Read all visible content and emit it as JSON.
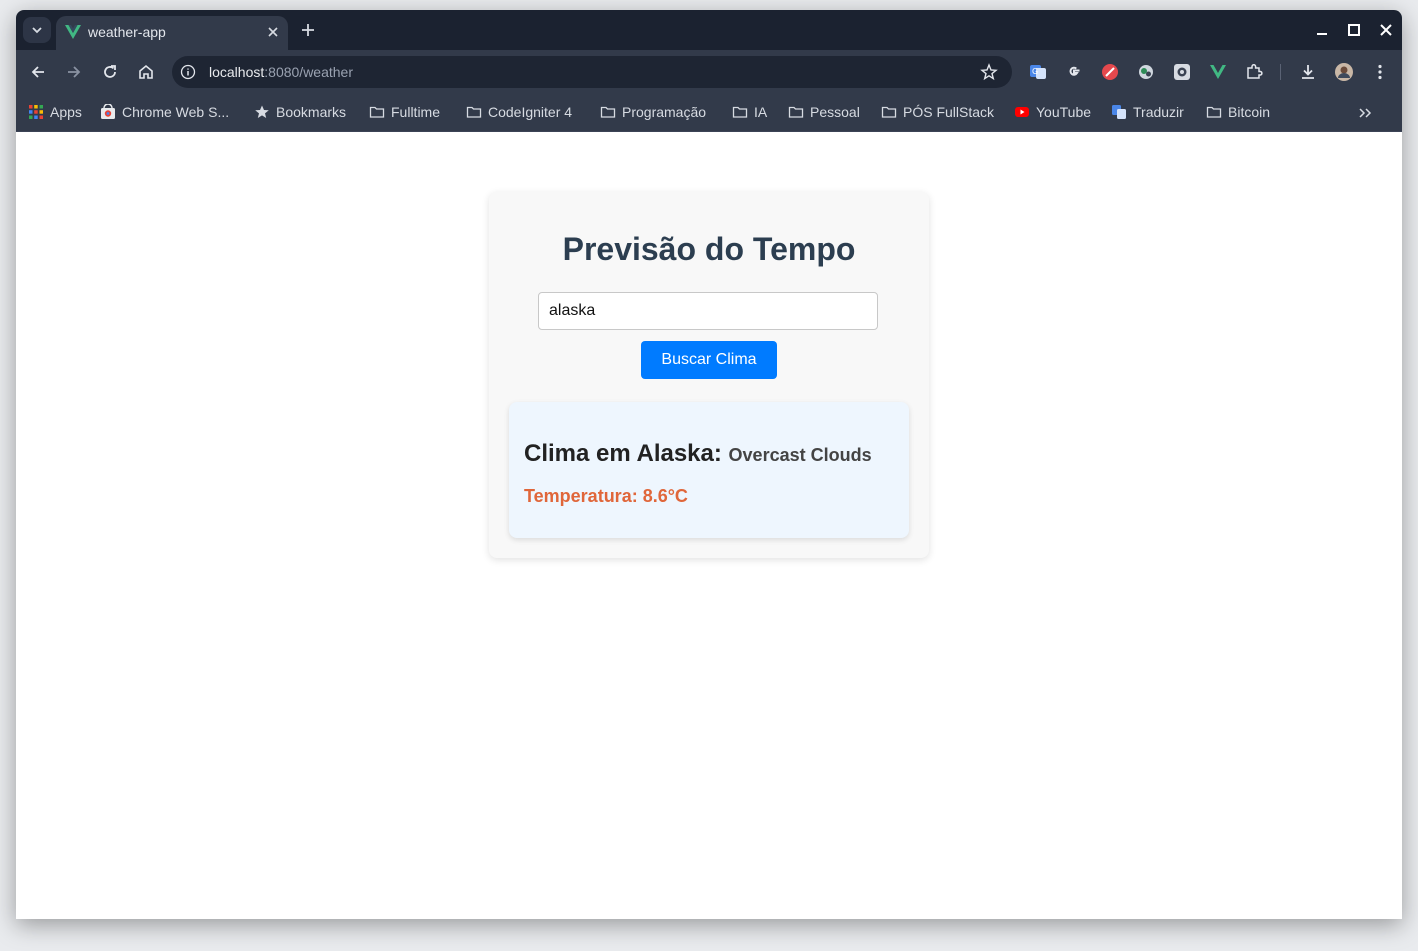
{
  "browser": {
    "tab": {
      "title": "weather-app"
    },
    "omnibox": {
      "host": "localhost",
      "path": ":8080/weather"
    },
    "bookmarks": [
      {
        "label": "Apps",
        "icon": "apps-grid-icon"
      },
      {
        "label": "Chrome Web S...",
        "icon": "chrome-web-store-icon"
      },
      {
        "label": "Bookmarks",
        "icon": "star-icon"
      },
      {
        "label": "Fulltime",
        "icon": "folder-icon"
      },
      {
        "label": "CodeIgniter 4",
        "icon": "folder-icon"
      },
      {
        "label": "Programação",
        "icon": "folder-icon"
      },
      {
        "label": "IA",
        "icon": "folder-icon"
      },
      {
        "label": "Pessoal",
        "icon": "folder-icon"
      },
      {
        "label": "PÓS FullStack",
        "icon": "folder-icon"
      },
      {
        "label": "YouTube",
        "icon": "youtube-icon"
      },
      {
        "label": "Traduzir",
        "icon": "google-translate-icon"
      },
      {
        "label": "Bitcoin",
        "icon": "folder-icon"
      }
    ]
  },
  "weather": {
    "title": "Previsão do Tempo",
    "input_value": "alaska",
    "button_label": "Buscar Clima",
    "result": {
      "city_label": "Clima em Alaska:",
      "description": "Overcast Clouds",
      "temperature": "Temperatura: 8.6°C"
    }
  },
  "colors": {
    "title": "#2c3e50",
    "button": "#007bff",
    "result_background": "#eef6fe",
    "temperature": "#e0663a",
    "chrome_frame": "#1b2230",
    "chrome_toolbar": "#323a4a"
  }
}
